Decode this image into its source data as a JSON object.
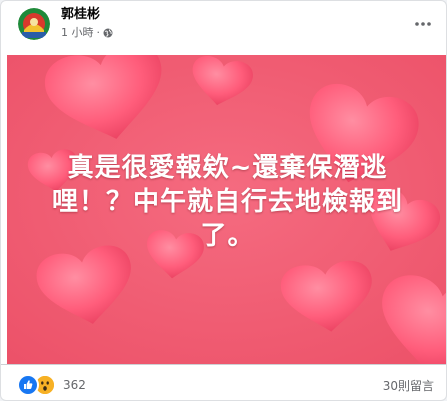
{
  "post": {
    "author": "郭桂彬",
    "time": "1 小時",
    "separator": "·",
    "privacy_icon": "globe-icon",
    "menu_icon": "more-horizontal-icon"
  },
  "image": {
    "caption_lines": [
      "真是很愛報欸~還棄保潛逃",
      "哩！？中午就自行去地檢報到",
      "了。"
    ],
    "background_color": "#f0546c",
    "heart_color": "#ff6a86"
  },
  "footer": {
    "reaction_icons": [
      "like-icon",
      "wow-icon"
    ],
    "reaction_count": "362",
    "comments": "30則留言"
  },
  "colors": {
    "like": "#1877f2",
    "wow": "#f7b125",
    "meta_text": "#65676b"
  }
}
